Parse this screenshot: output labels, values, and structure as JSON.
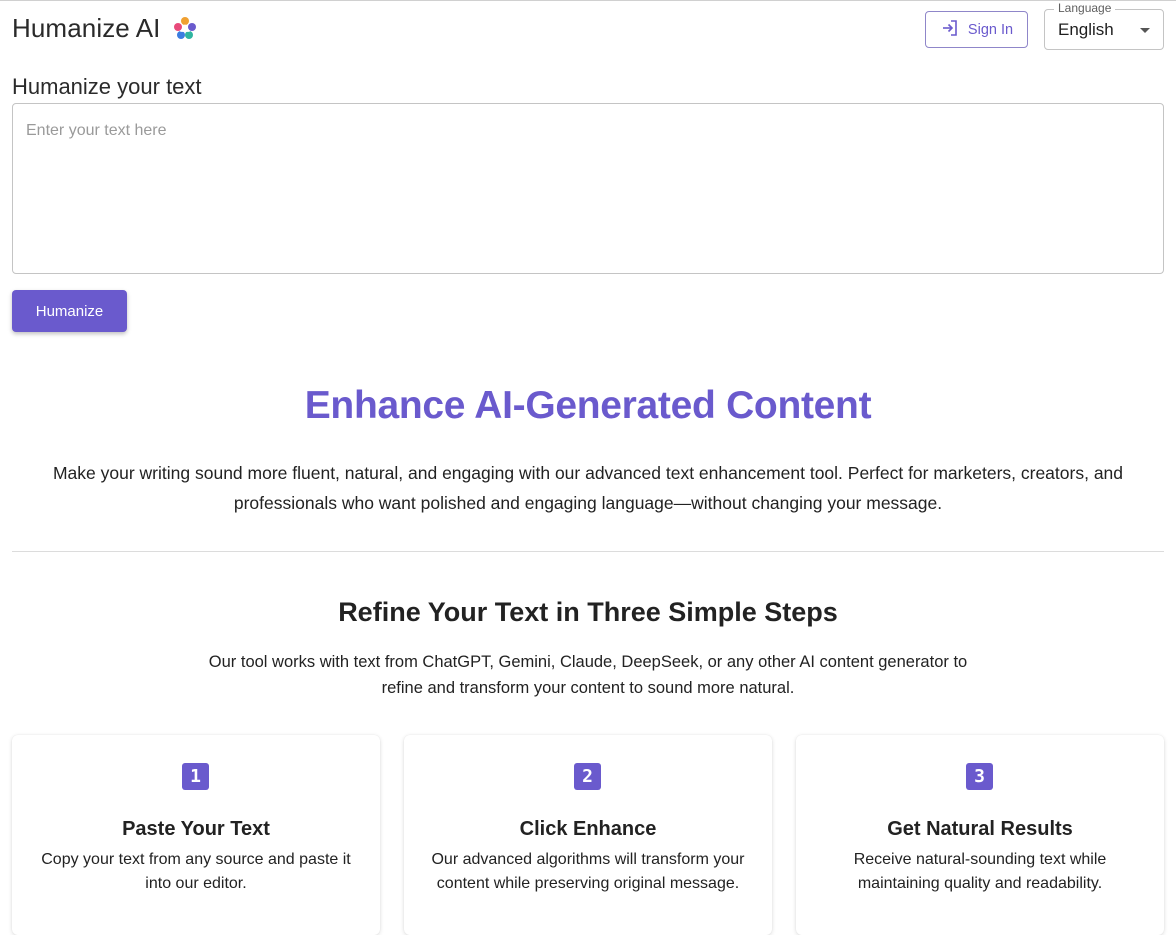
{
  "header": {
    "brand_name": "Humanize AI",
    "sign_in_label": "Sign In",
    "language_label": "Language",
    "language_value": "English"
  },
  "editor": {
    "title": "Humanize your text",
    "placeholder": "Enter your text here",
    "value": "",
    "submit_label": "Humanize"
  },
  "hero": {
    "title": "Enhance AI-Generated Content",
    "description": "Make your writing sound more fluent, natural, and engaging with our advanced text enhancement tool. Perfect for marketers, creators, and professionals who want polished and engaging language—without changing your message."
  },
  "steps_section": {
    "title": "Refine Your Text in Three Simple Steps",
    "description": "Our tool works with text from ChatGPT, Gemini, Claude, DeepSeek, or any other AI content generator to refine and transform your content to sound more natural.",
    "steps": [
      {
        "number": "1",
        "title": "Paste Your Text",
        "text": "Copy your text from any source and paste it into our editor."
      },
      {
        "number": "2",
        "title": "Click Enhance",
        "text": "Our advanced algorithms will transform your content while preserving original message."
      },
      {
        "number": "3",
        "title": "Get Natural Results",
        "text": "Receive natural-sounding text while maintaining quality and readability."
      }
    ]
  },
  "icons": {
    "brand_logo": "brand-logo-icon",
    "sign_in": "sign-in-icon",
    "language_dropdown": "caret-down-icon"
  },
  "colors": {
    "accent": "#6a5acd",
    "text": "#222222",
    "border": "#c4c4c4"
  }
}
